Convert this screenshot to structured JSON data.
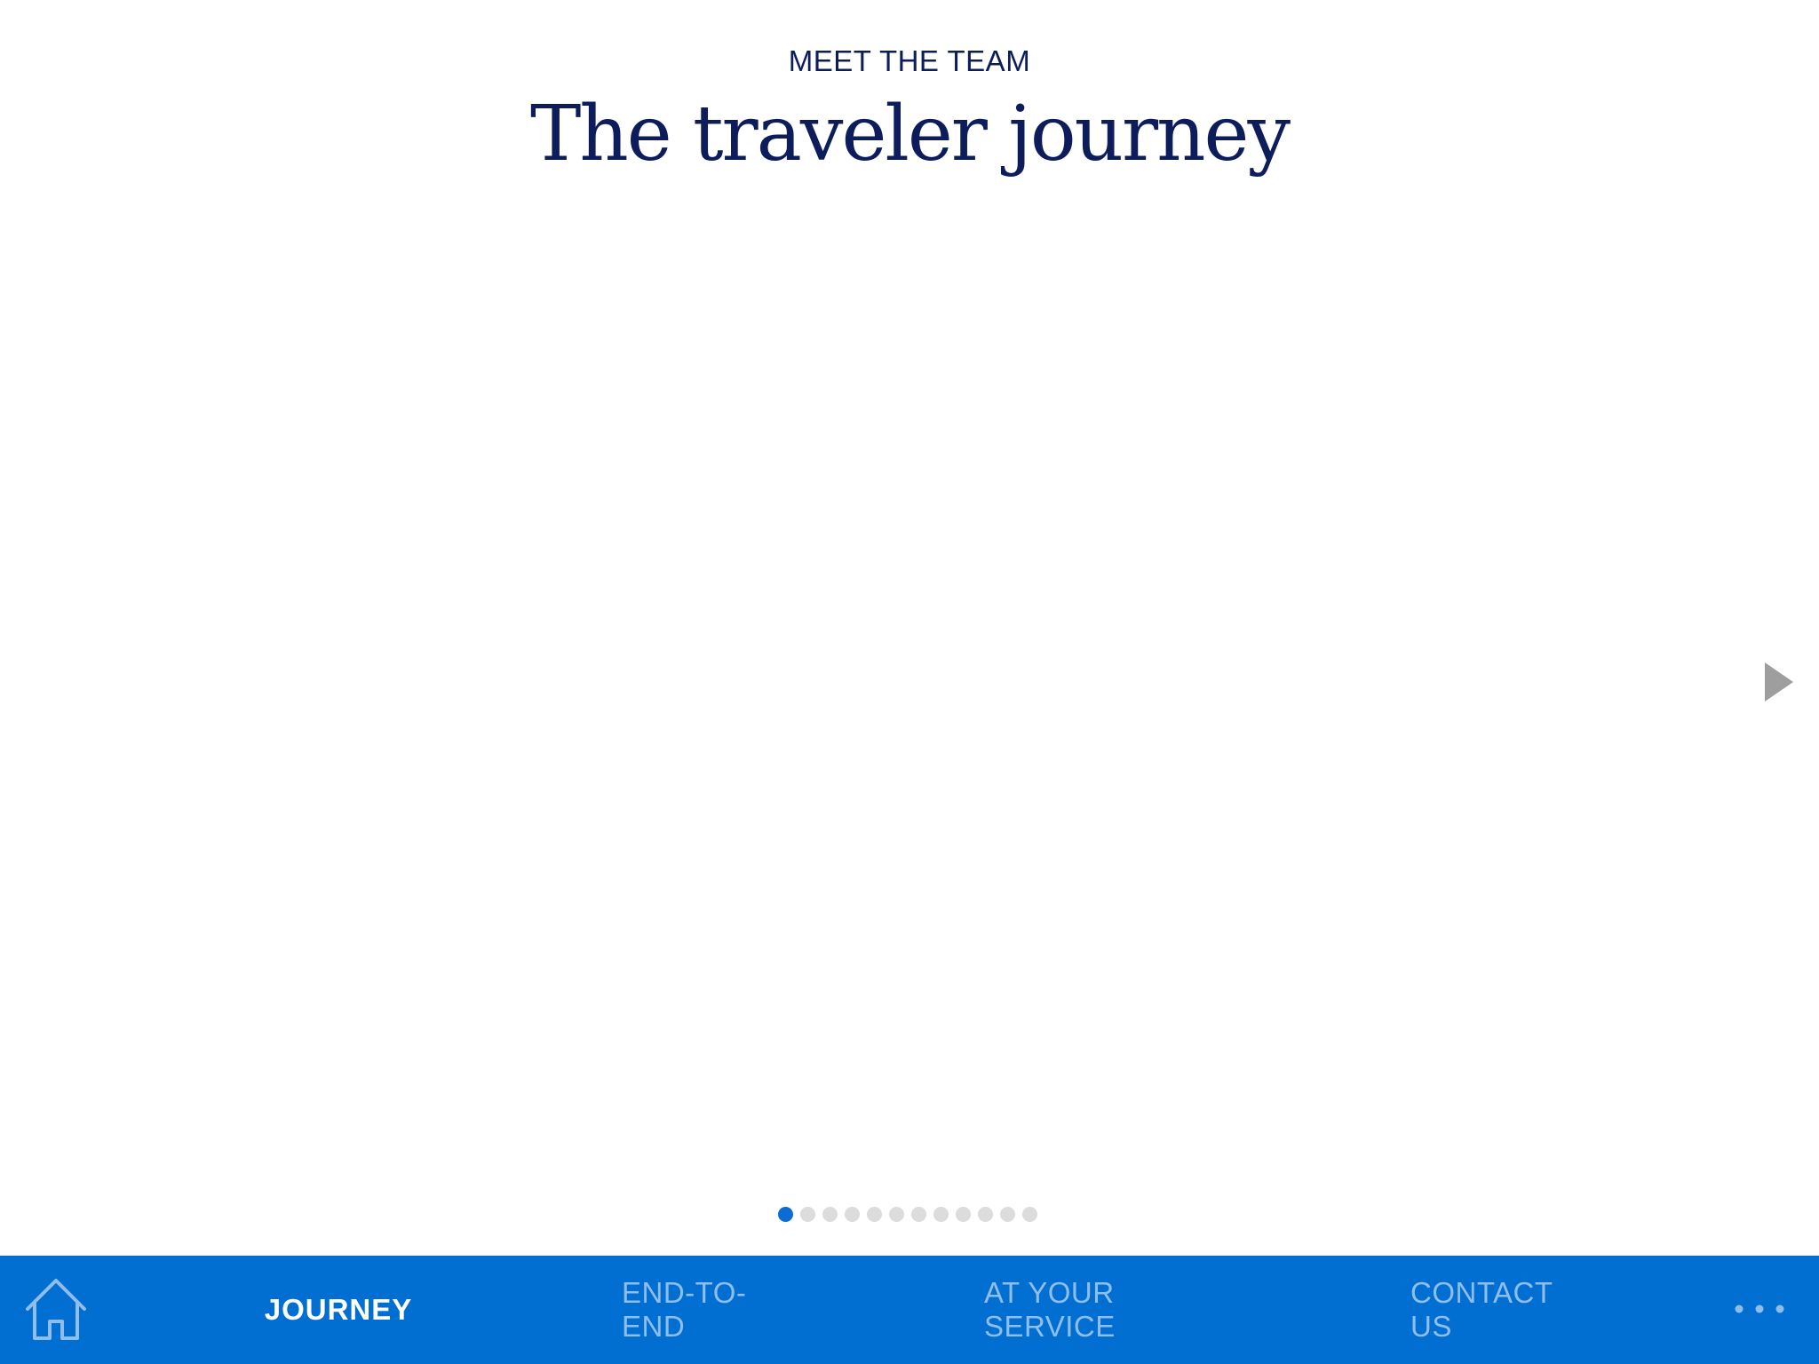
{
  "header": {
    "eyebrow": "MEET THE TEAM",
    "title": "The traveler journey"
  },
  "carousel": {
    "next_icon": "play-triangle-icon",
    "page_count": 12,
    "active_page": 1
  },
  "tabbar": {
    "home_icon": "home-icon",
    "tabs": [
      {
        "label": "JOURNEY",
        "active": true
      },
      {
        "label": "END-TO-END",
        "active": false
      },
      {
        "label": "AT YOUR SERVICE",
        "active": false
      },
      {
        "label": "CONTACT US",
        "active": false
      }
    ],
    "more_icon": "ellipsis-icon"
  },
  "colors": {
    "title_navy": "#0d1d5c",
    "tabbar_blue": "#006fd1",
    "tab_inactive": "#8fbeec",
    "dot_active": "#0b6dd4",
    "dot_inactive": "#dcdcdc",
    "arrow_gray": "#9e9e9e"
  }
}
